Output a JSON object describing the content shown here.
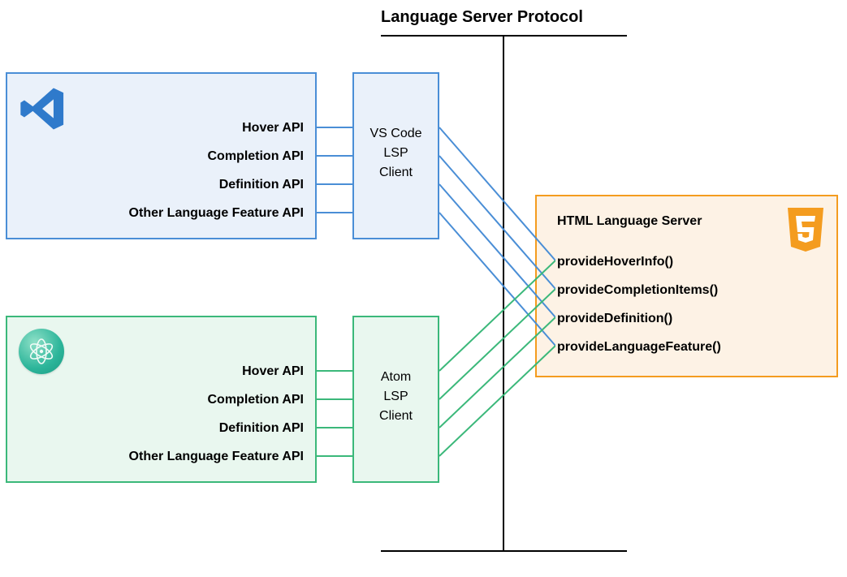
{
  "title": "Language Server Protocol",
  "vscode": {
    "apis": [
      "Hover API",
      "Completion API",
      "Definition API",
      "Other Language Feature API"
    ],
    "client_label": "VS Code\nLSP\nClient"
  },
  "atom": {
    "apis": [
      "Hover API",
      "Completion API",
      "Definition API",
      "Other Language Feature API"
    ],
    "client_label": "Atom\nLSP\nClient"
  },
  "server": {
    "title": "HTML Language Server",
    "methods": [
      "provideHoverInfo()",
      "provideCompletionItems()",
      "provideDefinition()",
      "provideLanguageFeature()"
    ]
  },
  "colors": {
    "blue": "#4a8ed6",
    "green": "#3bb87a",
    "orange": "#f49c1f"
  }
}
